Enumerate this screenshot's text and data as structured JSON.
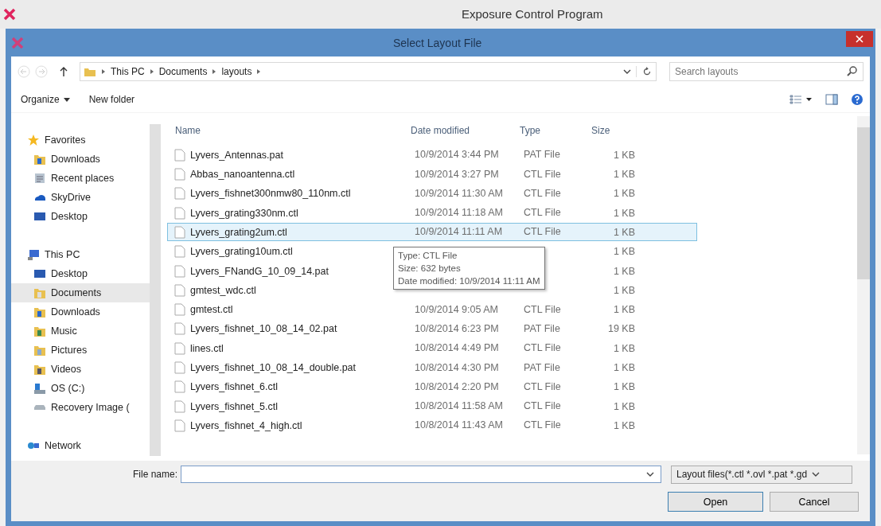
{
  "app": {
    "title": "Exposure Control Program"
  },
  "dialog": {
    "title": "Select Layout File"
  },
  "breadcrumb": [
    "This PC",
    "Documents",
    "layouts"
  ],
  "search": {
    "placeholder": "Search layouts"
  },
  "commands": {
    "organize": "Organize",
    "new_folder": "New folder"
  },
  "sidebar": [
    {
      "label": "Favorites",
      "selected": false,
      "children": [
        {
          "label": "Downloads",
          "selected": false
        },
        {
          "label": "Recent places",
          "selected": false
        },
        {
          "label": "SkyDrive",
          "selected": false
        },
        {
          "label": "Desktop",
          "selected": false
        }
      ]
    },
    {
      "label": "This PC",
      "selected": false,
      "children": [
        {
          "label": "Desktop",
          "selected": false
        },
        {
          "label": "Documents",
          "selected": true
        },
        {
          "label": "Downloads",
          "selected": false
        },
        {
          "label": "Music",
          "selected": false
        },
        {
          "label": "Pictures",
          "selected": false
        },
        {
          "label": "Videos",
          "selected": false
        },
        {
          "label": "OS (C:)",
          "selected": false
        },
        {
          "label": "Recovery Image (",
          "selected": false
        }
      ]
    },
    {
      "label": "Network",
      "selected": false
    }
  ],
  "table": {
    "columns": [
      "Name",
      "Date modified",
      "Type",
      "Size"
    ],
    "rows": [
      {
        "name": "Lyvers_Antennas.pat",
        "date": "10/9/2014 3:44 PM",
        "type": "PAT File",
        "size": "1 KB",
        "selected": false
      },
      {
        "name": "Abbas_nanoantenna.ctl",
        "date": "10/9/2014 3:27 PM",
        "type": "CTL File",
        "size": "1 KB",
        "selected": false
      },
      {
        "name": "Lyvers_fishnet300nmw80_110nm.ctl",
        "date": "10/9/2014 11:30 AM",
        "type": "CTL File",
        "size": "1 KB",
        "selected": false
      },
      {
        "name": "Lyvers_grating330nm.ctl",
        "date": "10/9/2014 11:18 AM",
        "type": "CTL File",
        "size": "1 KB",
        "selected": false
      },
      {
        "name": "Lyvers_grating2um.ctl",
        "date": "10/9/2014 11:11 AM",
        "type": "CTL File",
        "size": "1 KB",
        "selected": true
      },
      {
        "name": "Lyvers_grating10um.ctl",
        "size": "1 KB",
        "selected": false
      },
      {
        "name": "Lyvers_FNandG_10_09_14.pat",
        "size": "1 KB",
        "selected": false
      },
      {
        "name": "gmtest_wdc.ctl",
        "size": "1 KB",
        "selected": false
      },
      {
        "name": "gmtest.ctl",
        "date": "10/9/2014 9:05 AM",
        "type": "CTL File",
        "size": "1 KB",
        "selected": false
      },
      {
        "name": "Lyvers_fishnet_10_08_14_02.pat",
        "date": "10/8/2014 6:23 PM",
        "type": "PAT File",
        "size": "19 KB",
        "selected": false
      },
      {
        "name": "lines.ctl",
        "date": "10/8/2014 4:49 PM",
        "type": "CTL File",
        "size": "1 KB",
        "selected": false
      },
      {
        "name": "Lyvers_fishnet_10_08_14_double.pat",
        "date": "10/8/2014 4:30 PM",
        "type": "PAT File",
        "size": "1 KB",
        "selected": false
      },
      {
        "name": "Lyvers_fishnet_6.ctl",
        "date": "10/8/2014 2:20 PM",
        "type": "CTL File",
        "size": "1 KB",
        "selected": false
      },
      {
        "name": "Lyvers_fishnet_5.ctl",
        "date": "10/8/2014 11:58 AM",
        "type": "CTL File",
        "size": "1 KB",
        "selected": false
      },
      {
        "name": "Lyvers_fishnet_4_high.ctl",
        "date": "10/8/2014 11:43 AM",
        "type": "CTL File",
        "size": "1 KB",
        "selected": false
      }
    ]
  },
  "tooltip": [
    "Type: CTL File",
    "Size: 632 bytes",
    "Date modified: 10/9/2014 11:11 AM"
  ],
  "file_name": {
    "label": "File name:"
  },
  "filter": {
    "value": "Layout files(*.ctl *.ovl *.pat *.gd"
  },
  "buttons": [
    "Open",
    "Cancel"
  ]
}
